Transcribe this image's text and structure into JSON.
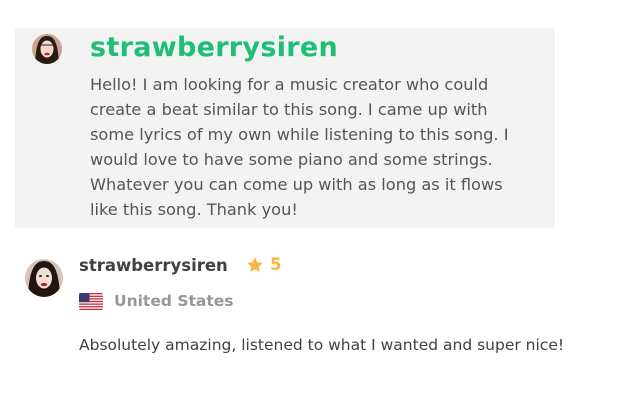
{
  "request": {
    "avatar_icon": "user-avatar-icon",
    "username": "strawberrysiren",
    "message": "Hello! I am looking for a music creator who could create a beat similar to this song. I came up with some lyrics of my own while listening to this song. I would love to have some piano and some strings. Whatever you can come up with as long as it flows like this song. Thank you!"
  },
  "review": {
    "avatar_icon": "user-avatar-icon",
    "username": "strawberrysiren",
    "star_icon": "star-icon",
    "rating": "5",
    "flag_icon": "us-flag-icon",
    "country": "United States",
    "text": "Absolutely amazing, listened to what I wanted and super nice!"
  },
  "colors": {
    "accent_green": "#1dbf73",
    "star_yellow": "#ffb33e",
    "card_background": "#f3f3f3"
  }
}
